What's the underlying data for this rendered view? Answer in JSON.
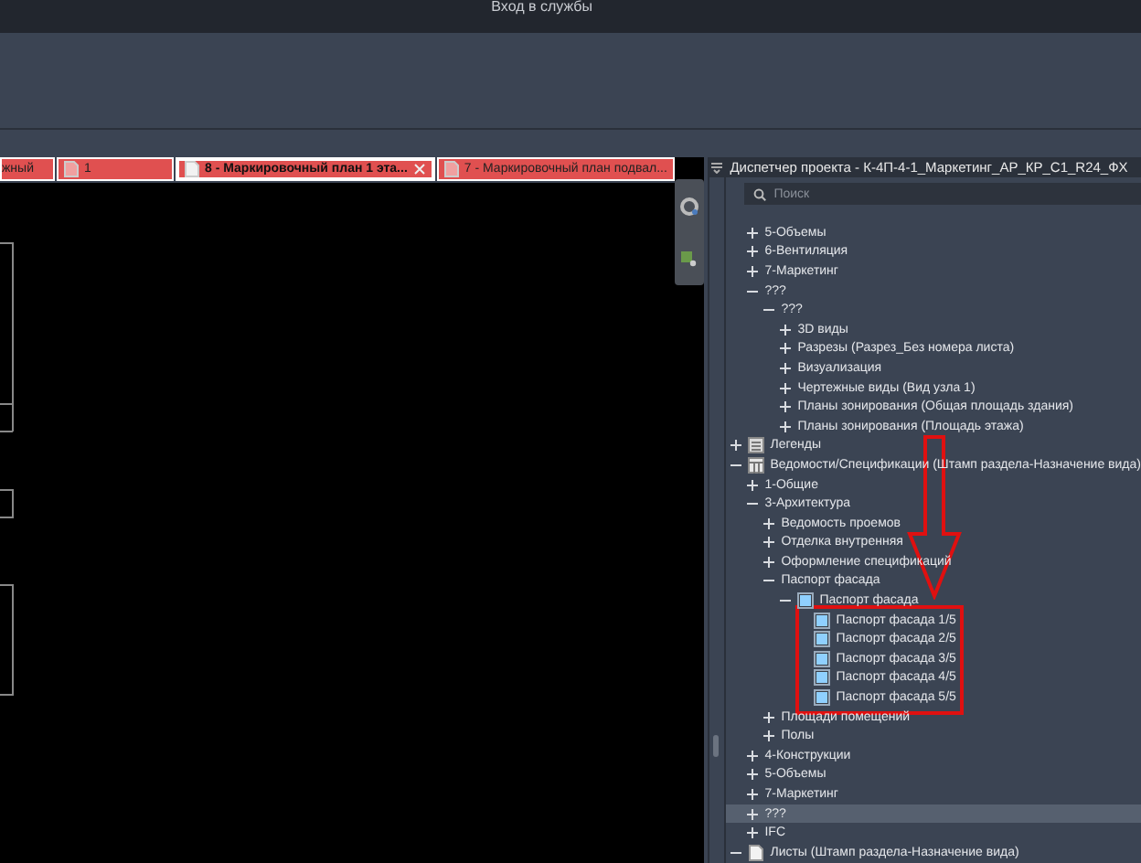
{
  "top_bar": {
    "sign_in": "Вход в службы"
  },
  "tabs": [
    {
      "label": "жный",
      "selected": false
    },
    {
      "label": "1",
      "selected": false
    },
    {
      "label": "8 - Маркировочный план 1 эта...",
      "selected": true
    },
    {
      "label": "7 - Маркировочный план подвал...",
      "selected": false
    }
  ],
  "project_browser": {
    "title": "Диспетчер проекта - К-4П-4-1_Маркетинг_АР_КР_С1_R24_ФХ",
    "search": {
      "placeholder": "Поиск"
    },
    "tree": [
      {
        "children": [
          {
            "label": "5-Объемы",
            "expanded": false,
            "selected": false
          },
          {
            "label": "6-Вентиляция",
            "expanded": false,
            "selected": false
          },
          {
            "label": "7-Маркетинг",
            "expanded": false,
            "selected": false
          },
          {
            "label": "???",
            "expanded": true,
            "selected": false,
            "children": [
              {
                "label": "???",
                "expanded": true,
                "selected": false,
                "children": [
                  {
                    "label": "3D виды",
                    "expanded": false,
                    "selected": false
                  },
                  {
                    "label": "Разрезы (Разрез_Без номера листа)",
                    "expanded": false,
                    "selected": false
                  },
                  {
                    "label": "Визуализация",
                    "expanded": false,
                    "selected": false
                  },
                  {
                    "label": "Чертежные виды (Вид узла 1)",
                    "expanded": false,
                    "selected": false
                  },
                  {
                    "label": "Планы зонирования (Общая площадь здания)",
                    "expanded": false,
                    "selected": false
                  },
                  {
                    "label": "Планы зонирования (Площадь этажа)",
                    "expanded": false,
                    "selected": false
                  }
                ]
              }
            ]
          }
        ]
      },
      {
        "label": "Легенды",
        "kind": "legend",
        "expanded": false,
        "selected": false
      },
      {
        "label": "Ведомости/Спецификации (Штамп раздела-Назначение вида)",
        "kind": "schedule",
        "expanded": true,
        "selected": false,
        "children": [
          {
            "label": "1-Общие",
            "expanded": false,
            "selected": false
          },
          {
            "label": "3-Архитектура",
            "expanded": true,
            "selected": false,
            "children": [
              {
                "label": "Ведомость проемов",
                "expanded": false,
                "selected": false
              },
              {
                "label": "Отделка внутренняя",
                "expanded": false,
                "selected": false
              },
              {
                "label": "Оформление спецификаций",
                "expanded": false,
                "selected": false
              },
              {
                "label": "Паспорт фасада",
                "expanded": true,
                "selected": false,
                "children": [
                  {
                    "label": "Паспорт фасада",
                    "kind": "view",
                    "expanded": true,
                    "selected": false,
                    "children": [
                      {
                        "label": "Паспорт фасада 1/5",
                        "kind": "view",
                        "selected": false
                      },
                      {
                        "label": "Паспорт фасада 2/5",
                        "kind": "view",
                        "selected": false
                      },
                      {
                        "label": "Паспорт фасада 3/5",
                        "kind": "view",
                        "selected": false
                      },
                      {
                        "label": "Паспорт фасада 4/5",
                        "kind": "view",
                        "selected": false
                      },
                      {
                        "label": "Паспорт фасада 5/5",
                        "kind": "view",
                        "selected": false
                      }
                    ]
                  }
                ]
              },
              {
                "label": "Площади помещений",
                "expanded": false,
                "selected": false
              },
              {
                "label": "Полы",
                "expanded": false,
                "selected": false
              }
            ]
          },
          {
            "label": "4-Конструкции",
            "expanded": false,
            "selected": false
          },
          {
            "label": "5-Объемы",
            "expanded": false,
            "selected": false
          },
          {
            "label": "7-Маркетинг",
            "expanded": false,
            "selected": false
          },
          {
            "label": "???",
            "expanded": false,
            "selected": true
          },
          {
            "label": "IFC",
            "expanded": false,
            "selected": false
          }
        ]
      },
      {
        "label": "Листы (Штамп раздела-Назначение вида)",
        "kind": "sheet",
        "expanded": true,
        "selected": false
      }
    ]
  }
}
